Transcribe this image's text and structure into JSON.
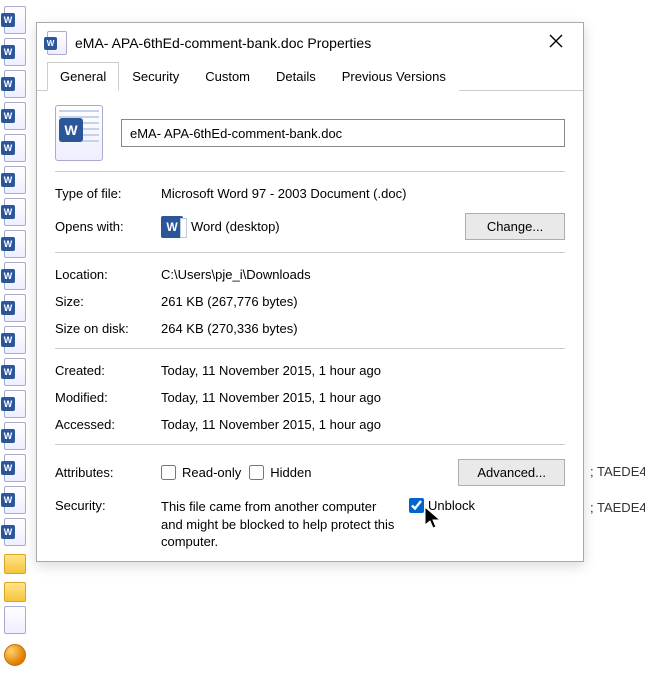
{
  "dialog": {
    "title": "eMA- APA-6thEd-comment-bank.doc Properties",
    "tabs": [
      "General",
      "Security",
      "Custom",
      "Details",
      "Previous Versions"
    ],
    "filename": "eMA- APA-6thEd-comment-bank.doc",
    "type_of_file": {
      "label": "Type of file:",
      "value": "Microsoft Word 97 - 2003 Document (.doc)"
    },
    "opens_with": {
      "label": "Opens with:",
      "value": "Word (desktop)",
      "change_btn": "Change..."
    },
    "location": {
      "label": "Location:",
      "value": "C:\\Users\\pje_i\\Downloads"
    },
    "size": {
      "label": "Size:",
      "value": "261 KB (267,776 bytes)"
    },
    "size_on_disk": {
      "label": "Size on disk:",
      "value": "264 KB (270,336 bytes)"
    },
    "created": {
      "label": "Created:",
      "value": "Today, 11 November 2015, 1 hour ago"
    },
    "modified": {
      "label": "Modified:",
      "value": "Today, 11 November 2015, 1 hour ago"
    },
    "accessed": {
      "label": "Accessed:",
      "value": "Today, 11 November 2015, 1 hour ago"
    },
    "attributes": {
      "label": "Attributes:",
      "readonly": "Read-only",
      "hidden": "Hidden",
      "advanced_btn": "Advanced..."
    },
    "security": {
      "label": "Security:",
      "message": "This file came from another computer and might be blocked to help protect this computer.",
      "unblock": "Unblock"
    }
  },
  "background": {
    "label1": "; TAEDE4",
    "label2": "; TAEDE4"
  }
}
